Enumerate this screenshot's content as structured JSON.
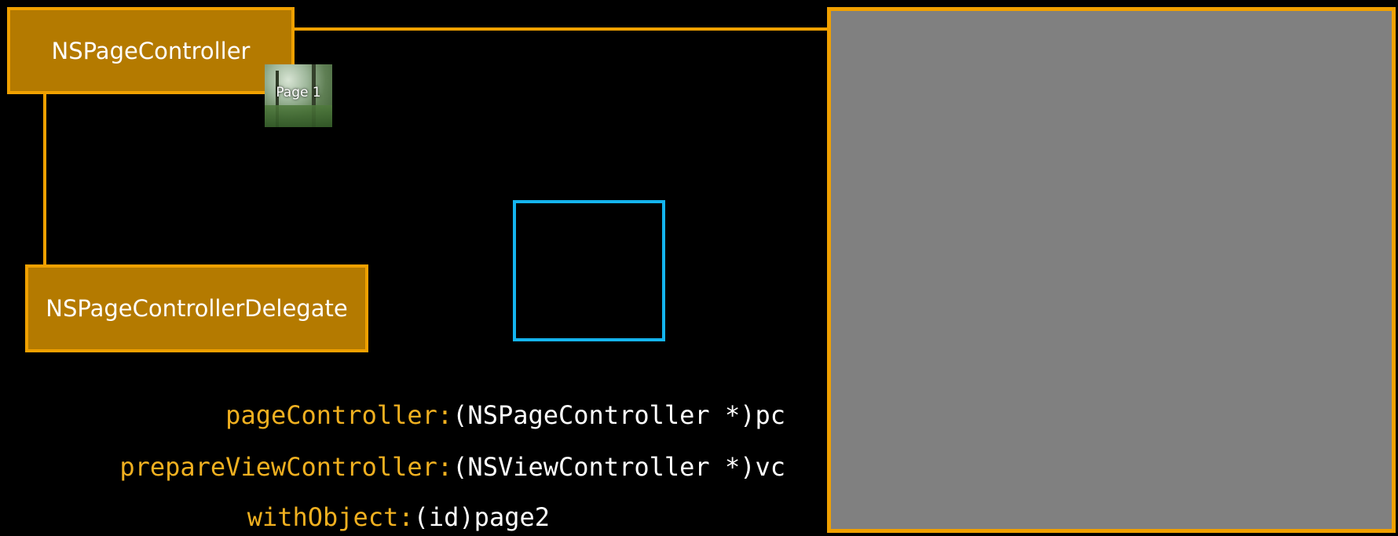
{
  "nodes": {
    "page_controller": "NSPageController",
    "page_controller_delegate": "NSPageControllerDelegate"
  },
  "thumbnail": {
    "label": "Page 1"
  },
  "code": [
    {
      "selector": "pageController:",
      "arg": "(NSPageController *)pc"
    },
    {
      "selector": "prepareViewController:",
      "arg": "(NSViewController *)vc"
    },
    {
      "selector": "withObject:",
      "arg": "(id)page2"
    }
  ],
  "colors": {
    "box_fill": "#b47a00",
    "box_border": "#f0a000",
    "selector_text": "#f0b020",
    "highlight_frame": "#14b4ef",
    "panel": "#808080"
  }
}
